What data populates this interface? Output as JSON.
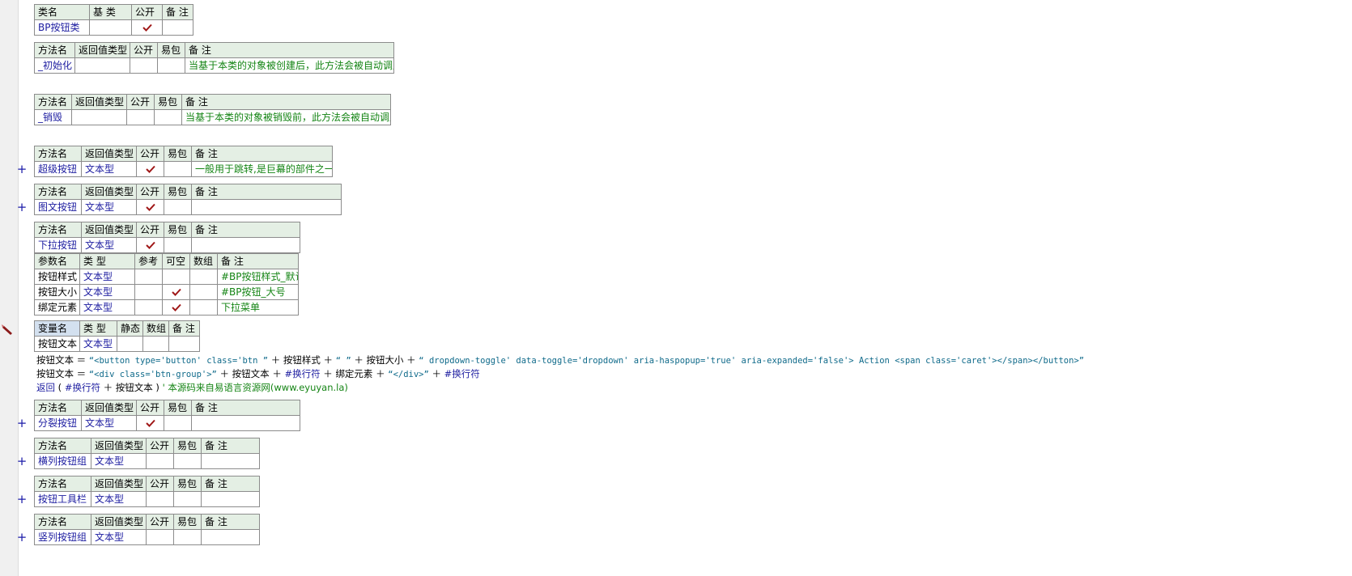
{
  "class_table": {
    "headers": [
      "类名",
      "基 类",
      "公开",
      "备 注"
    ],
    "name": "BP按钮类",
    "base": "",
    "public": true,
    "note": ""
  },
  "methods": [
    {
      "key": "m1",
      "headers": [
        "方法名",
        "返回值类型",
        "公开",
        "易包",
        "备 注"
      ],
      "name": "_初始化",
      "ret": "",
      "public": false,
      "easy": false,
      "note": "当基于本类的对象被创建后，此方法会被自动调用",
      "expandable": false
    },
    {
      "key": "m2",
      "headers": [
        "方法名",
        "返回值类型",
        "公开",
        "易包",
        "备 注"
      ],
      "name": "_销毁",
      "ret": "",
      "public": false,
      "easy": false,
      "note": "当基于本类的对象被销毁前，此方法会被自动调用",
      "expandable": false
    },
    {
      "key": "m3",
      "headers": [
        "方法名",
        "返回值类型",
        "公开",
        "易包",
        "备 注"
      ],
      "name": "超级按钮",
      "ret": "文本型",
      "public": true,
      "easy": false,
      "note": "一般用于跳转,是巨幕的部件之一",
      "expandable": true
    },
    {
      "key": "m4",
      "headers": [
        "方法名",
        "返回值类型",
        "公开",
        "易包",
        "备 注"
      ],
      "name": "图文按钮",
      "ret": "文本型",
      "public": true,
      "easy": false,
      "note": "",
      "expandable": true
    },
    {
      "key": "m5",
      "headers": [
        "方法名",
        "返回值类型",
        "公开",
        "易包",
        "备 注"
      ],
      "name": "下拉按钮",
      "ret": "文本型",
      "public": true,
      "easy": false,
      "note": "",
      "expandable": false
    },
    {
      "key": "m6",
      "headers": [
        "方法名",
        "返回值类型",
        "公开",
        "易包",
        "备 注"
      ],
      "name": "分裂按钮",
      "ret": "文本型",
      "public": true,
      "easy": false,
      "note": "",
      "expandable": true
    },
    {
      "key": "m7",
      "headers": [
        "方法名",
        "返回值类型",
        "公开",
        "易包",
        "备 注"
      ],
      "name": "横列按钮组",
      "ret": "文本型",
      "public": false,
      "easy": false,
      "note": "",
      "expandable": true
    },
    {
      "key": "m8",
      "headers": [
        "方法名",
        "返回值类型",
        "公开",
        "易包",
        "备 注"
      ],
      "name": "按钮工具栏",
      "ret": "文本型",
      "public": false,
      "easy": false,
      "note": "",
      "expandable": true
    },
    {
      "key": "m9",
      "headers": [
        "方法名",
        "返回值类型",
        "公开",
        "易包",
        "备 注"
      ],
      "name": "竖列按钮组",
      "ret": "文本型",
      "public": false,
      "easy": false,
      "note": "",
      "expandable": true
    }
  ],
  "params": {
    "headers": [
      "参数名",
      "类 型",
      "参考",
      "可空",
      "数组",
      "备 注"
    ],
    "rows": [
      {
        "name": "按钮样式",
        "type": "文本型",
        "ref": false,
        "nullable": false,
        "array": false,
        "note": "#BP按钮样式_默认"
      },
      {
        "name": "按钮大小",
        "type": "文本型",
        "ref": false,
        "nullable": true,
        "array": false,
        "note": "#BP按钮_大号"
      },
      {
        "name": "绑定元素",
        "type": "文本型",
        "ref": false,
        "nullable": true,
        "array": false,
        "note": "下拉菜单"
      }
    ]
  },
  "locals": {
    "headers": [
      "变量名",
      "类 型",
      "静态",
      "数组",
      "备 注"
    ],
    "name": "按钮文本",
    "type": "文本型",
    "static": false,
    "array": false,
    "note": ""
  },
  "code": {
    "line1": {
      "var": "按钮文本",
      "op": "＝",
      "s1": "“<button type='button' class='btn ”",
      "plus": "＋",
      "v1": "按钮样式",
      "s2": "“ ”",
      "v2": "按钮大小",
      "s3": "“ dropdown-toggle' data-toggle='dropdown' aria-haspopup='true' aria-expanded='false'> Action <span class='caret'></span></button>”"
    },
    "line2": {
      "var": "按钮文本",
      "op": "＝",
      "s1": "“<div class='btn-group'>”",
      "plus": "＋",
      "v1": "按钮文本",
      "c1": "#换行符",
      "v2": "绑定元素",
      "s2": "“</div>”",
      "c2": "#换行符"
    },
    "line3": {
      "kw": "返回",
      "open": "(",
      "c1": "#换行符",
      "plus": "＋",
      "v1": "按钮文本",
      "close": ")",
      "comment": "' 本源码来自易语言资源网(www.eyuyan.la)"
    }
  },
  "icons": {
    "expand": "plus-icon",
    "check": "checkmark-icon",
    "edit": "pencil-icon"
  },
  "colors": {
    "header_bg": "#e4efe4",
    "selected_header_bg": "#d3e0ef",
    "identifier": "#1c1ca0",
    "comment": "#148414",
    "check": "#a01818"
  }
}
